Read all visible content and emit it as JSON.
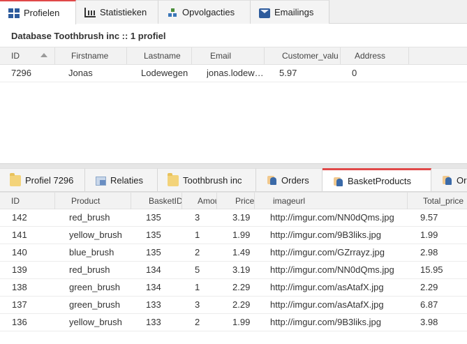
{
  "top_tabs": [
    {
      "label": "Profielen",
      "icon": "grid-icon",
      "active": true
    },
    {
      "label": "Statistieken",
      "icon": "chart-icon",
      "active": false
    },
    {
      "label": "Opvolgacties",
      "icon": "flow-icon",
      "active": false
    },
    {
      "label": "Emailings",
      "icon": "mail-icon",
      "active": false
    }
  ],
  "db_title": "Database Toothbrush inc :: 1 profiel",
  "profile_grid": {
    "columns": [
      "ID",
      "Firstname",
      "Lastname",
      "Email",
      "Customer_valu",
      "Address"
    ],
    "rows": [
      [
        "7296",
        "Jonas",
        "Lodewegen",
        "jonas.lodew…",
        "5.97",
        "0"
      ]
    ]
  },
  "bottom_tabs": [
    {
      "label": "Profiel 7296",
      "icon": "folder-icon",
      "active": false
    },
    {
      "label": "Relaties",
      "icon": "relations-icon",
      "active": false
    },
    {
      "label": "Toothbrush inc",
      "icon": "folder-icon",
      "active": false
    },
    {
      "label": "Orders",
      "icon": "person-icon",
      "active": false
    },
    {
      "label": "BasketProducts",
      "icon": "person-icon",
      "active": true
    },
    {
      "label": "Ord",
      "icon": "person-icon",
      "active": false
    }
  ],
  "basket_grid": {
    "columns": [
      "ID",
      "Product",
      "BasketID",
      "Amou",
      "Price",
      "imageurl",
      "Total_price"
    ],
    "rows": [
      [
        "142",
        "red_brush",
        "135",
        "3",
        "3.19",
        "http://imgur.com/NN0dQms.jpg",
        "9.57"
      ],
      [
        "141",
        "yellow_brush",
        "135",
        "1",
        "1.99",
        "http://imgur.com/9B3liks.jpg",
        "1.99"
      ],
      [
        "140",
        "blue_brush",
        "135",
        "2",
        "1.49",
        "http://imgur.com/GZrrayz.jpg",
        "2.98"
      ],
      [
        "139",
        "red_brush",
        "134",
        "5",
        "3.19",
        "http://imgur.com/NN0dQms.jpg",
        "15.95"
      ],
      [
        "138",
        "green_brush",
        "134",
        "1",
        "2.29",
        "http://imgur.com/asAtafX.jpg",
        "2.29"
      ],
      [
        "137",
        "green_brush",
        "133",
        "3",
        "2.29",
        "http://imgur.com/asAtafX.jpg",
        "6.87"
      ],
      [
        "136",
        "yellow_brush",
        "133",
        "2",
        "1.99",
        "http://imgur.com/9B3liks.jpg",
        "3.98"
      ]
    ]
  }
}
